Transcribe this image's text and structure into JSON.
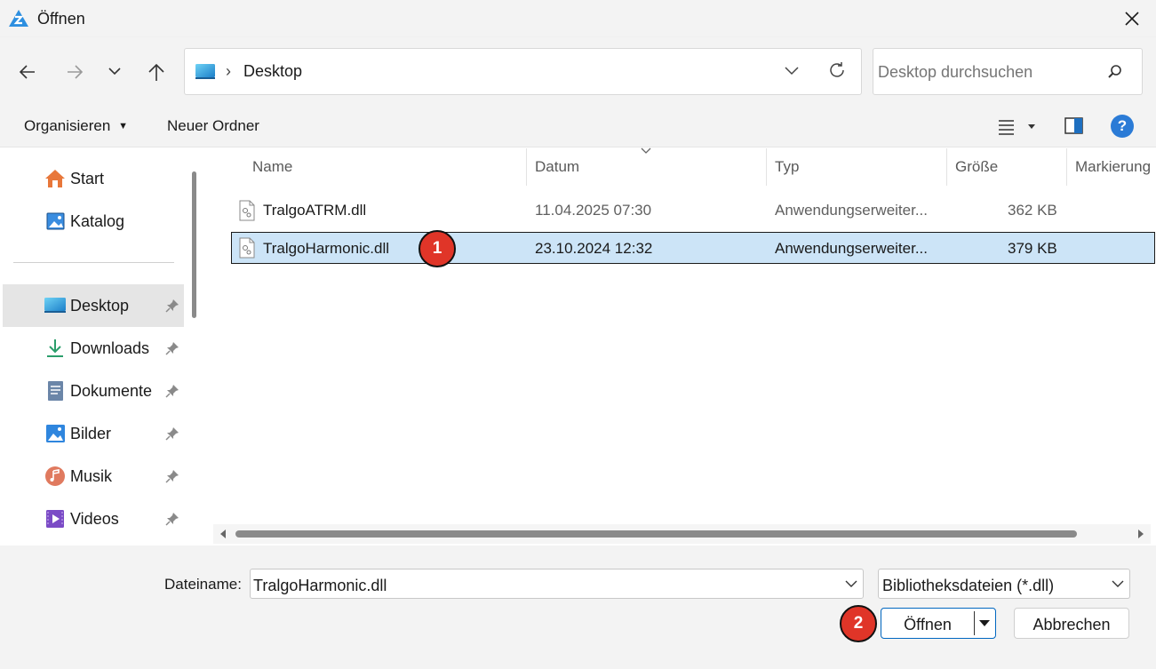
{
  "window": {
    "title": "Öffnen",
    "close_label": "✕"
  },
  "address": {
    "separator": "›",
    "location": "Desktop"
  },
  "search": {
    "placeholder": "Desktop durchsuchen"
  },
  "toolbar": {
    "organize": "Organisieren",
    "new_folder": "Neuer Ordner"
  },
  "nav": {
    "top_items": [
      {
        "label": "Start",
        "icon": "home-icon"
      },
      {
        "label": "Katalog",
        "icon": "gallery-icon"
      }
    ],
    "pinned_items": [
      {
        "label": "Desktop",
        "icon": "desktop-icon",
        "selected": true
      },
      {
        "label": "Downloads",
        "icon": "download-icon"
      },
      {
        "label": "Dokumente",
        "icon": "document-icon"
      },
      {
        "label": "Bilder",
        "icon": "pictures-icon"
      },
      {
        "label": "Musik",
        "icon": "music-icon"
      },
      {
        "label": "Videos",
        "icon": "video-icon"
      }
    ]
  },
  "columns": {
    "name": "Name",
    "date": "Datum",
    "type": "Typ",
    "size": "Größe",
    "tags": "Markierung"
  },
  "files": [
    {
      "name": "TralgoATRM.dll",
      "date": "11.04.2025 07:30",
      "type": "Anwendungserweiter...",
      "size": "362 KB",
      "selected": false
    },
    {
      "name": "TralgoHarmonic.dll",
      "date": "23.10.2024 12:32",
      "type": "Anwendungserweiter...",
      "size": "379 KB",
      "selected": true
    }
  ],
  "footer": {
    "filename_label": "Dateiname:",
    "filename_value": "TralgoHarmonic.dll",
    "filter_value": "Bibliotheksdateien (*.dll)",
    "open_label": "Öffnen",
    "cancel_label": "Abbrechen"
  },
  "annotations": {
    "badge1": "1",
    "badge2": "2"
  },
  "colors": {
    "accent": "#0067c0",
    "selection": "#cce4f7",
    "badge": "#e03528"
  }
}
